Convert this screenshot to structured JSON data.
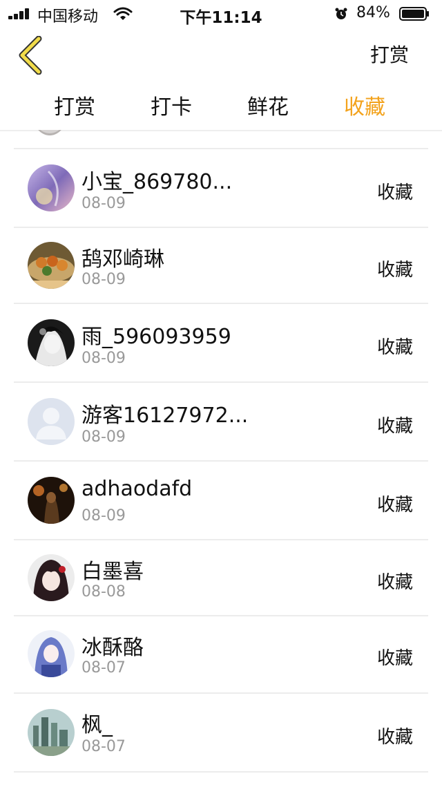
{
  "status_bar": {
    "carrier": "中国移动",
    "time": "下午11:14",
    "battery": "84%",
    "battery_level": 0.84
  },
  "nav": {
    "right_title": "打赏"
  },
  "tabs": [
    {
      "label": "打赏",
      "active": false
    },
    {
      "label": "打卡",
      "active": false
    },
    {
      "label": "鲜花",
      "active": false
    },
    {
      "label": "收藏",
      "active": true
    }
  ],
  "accent_color": "#F3A21B",
  "rows": [
    {
      "name": "小宝_869780...",
      "date": "08-09",
      "action": "收藏",
      "avatar": "purple-anime-avatar"
    },
    {
      "name": "鸹邓崎琳",
      "date": "08-09",
      "action": "收藏",
      "avatar": "food-photo-avatar"
    },
    {
      "name": "雨_596093959",
      "date": "08-09",
      "action": "收藏",
      "avatar": "bw-anime-avatar"
    },
    {
      "name": "游客16127972...",
      "date": "08-09",
      "action": "收藏",
      "avatar": "default-user-avatar"
    },
    {
      "name": "adhaodafd",
      "date": "08-09",
      "action": "收藏",
      "avatar": "dark-scene-avatar"
    },
    {
      "name": "白墨喜",
      "date": "08-08",
      "action": "收藏",
      "avatar": "red-hair-anime-avatar"
    },
    {
      "name": "冰酥酪",
      "date": "08-07",
      "action": "收藏",
      "avatar": "blue-anime-avatar"
    },
    {
      "name": "枫_",
      "date": "08-07",
      "action": "收藏",
      "avatar": "city-photo-avatar"
    }
  ]
}
